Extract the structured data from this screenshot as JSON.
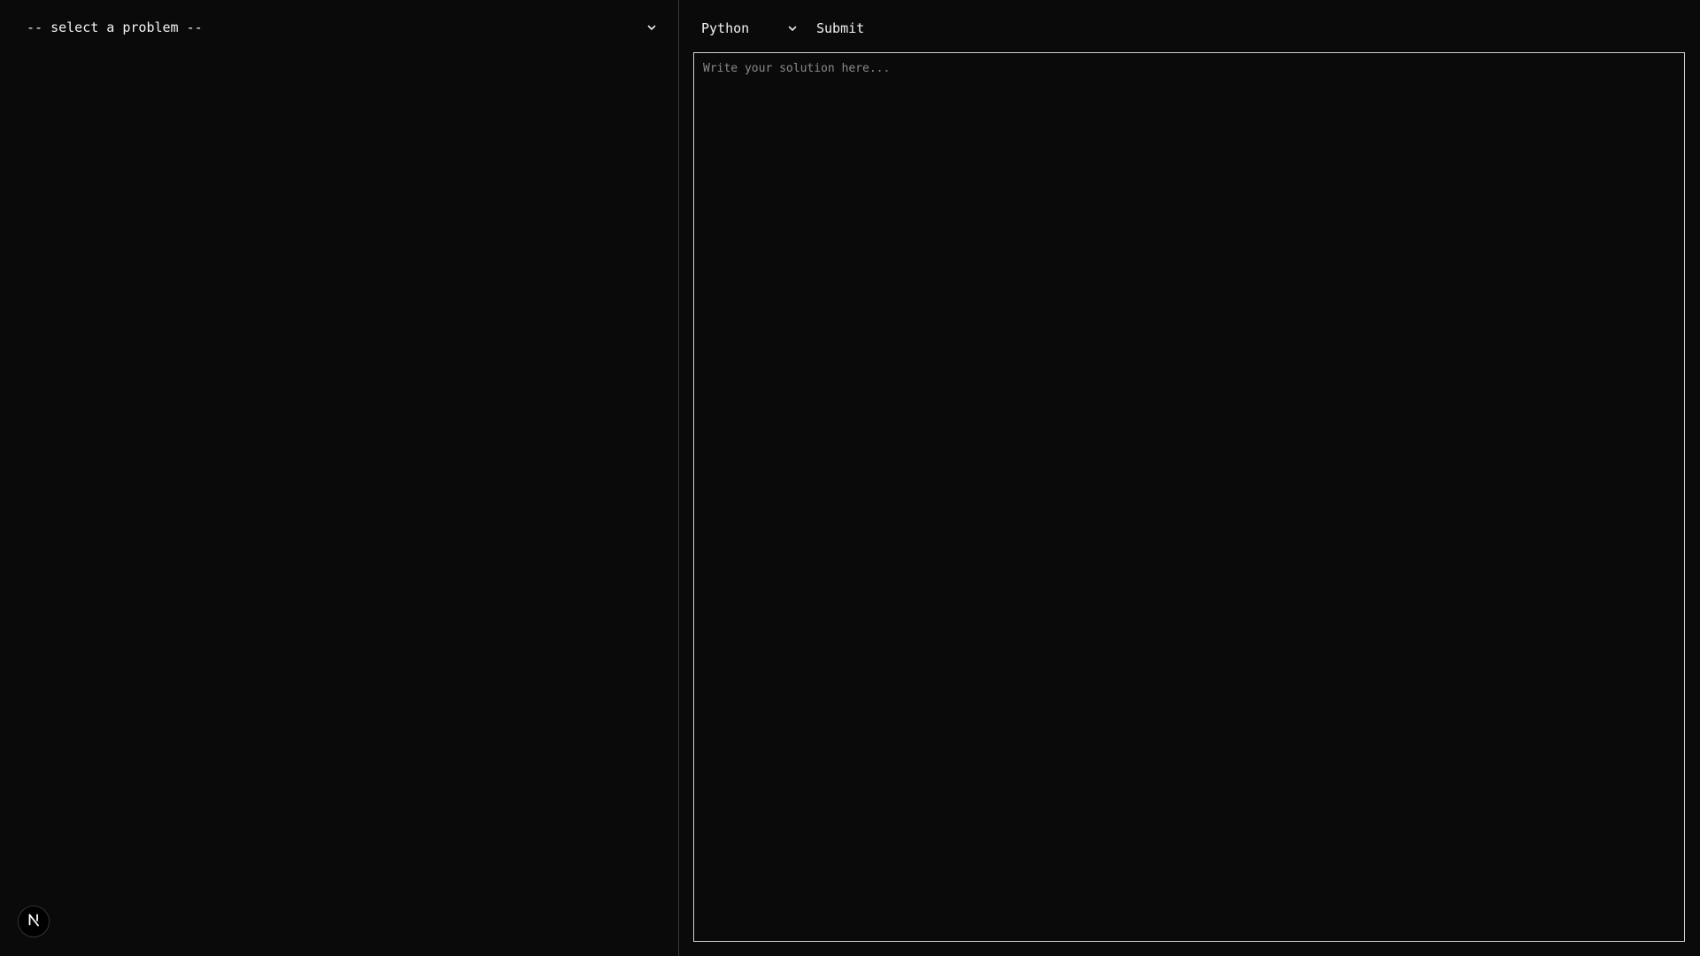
{
  "problem_select": {
    "selected": "-- select a problem --",
    "icon": "chevron-down-icon"
  },
  "toolbar": {
    "language": {
      "selected": "Python",
      "icon": "chevron-down-icon"
    },
    "submit_label": "Submit"
  },
  "editor": {
    "value": "",
    "placeholder": "Write your solution here..."
  },
  "dev_badge": {
    "icon": "nextjs-logo-icon"
  },
  "colors": {
    "background": "#0a0a0a",
    "text": "#ededed",
    "divider": "#3a3a3a",
    "editor_border": "#d0d0d0",
    "placeholder": "#8a8a8a"
  }
}
